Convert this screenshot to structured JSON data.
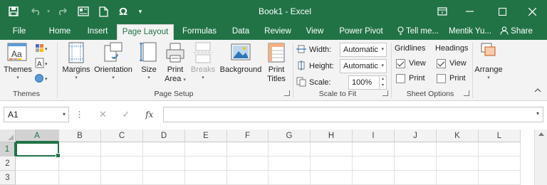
{
  "window": {
    "title": "Book1 - Excel",
    "accent": "#217346"
  },
  "quick_access": [
    "save-icon",
    "undo-icon",
    "redo-icon",
    "print-preview-icon",
    "document-icon",
    "symbol-icon",
    "customize-icon"
  ],
  "quick_access_symbol": "Ω",
  "tabs": [
    {
      "label": "File"
    },
    {
      "label": "Home"
    },
    {
      "label": "Insert"
    },
    {
      "label": "Page Layout",
      "active": true
    },
    {
      "label": "Formulas"
    },
    {
      "label": "Data"
    },
    {
      "label": "Review"
    },
    {
      "label": "View"
    },
    {
      "label": "Power Pivot"
    },
    {
      "label": "Tell me..."
    },
    {
      "label": "Mentik Yu..."
    },
    {
      "label": "Share"
    }
  ],
  "ribbon": {
    "themes": {
      "themes_label": "Themes",
      "group_label": "Themes"
    },
    "page_setup": {
      "margins": "Margins",
      "orientation": "Orientation",
      "size": "Size",
      "print_area_1": "Print",
      "print_area_2": "Area",
      "breaks": "Breaks",
      "background": "Background",
      "print_titles_1": "Print",
      "print_titles_2": "Titles",
      "group_label": "Page Setup"
    },
    "scale_to_fit": {
      "width_label": "Width:",
      "width_value": "Automatic",
      "height_label": "Height:",
      "height_value": "Automatic",
      "scale_label": "Scale:",
      "scale_value": "100%",
      "group_label": "Scale to Fit"
    },
    "sheet_options": {
      "gridlines": "Gridlines",
      "headings": "Headings",
      "view": "View",
      "print": "Print",
      "gridlines_view": true,
      "gridlines_print": false,
      "headings_view": true,
      "headings_print": false,
      "group_label": "Sheet Options"
    },
    "arrange": {
      "label": "Arrange"
    }
  },
  "formula_bar": {
    "name_box": "A1",
    "fx": "fx",
    "formula": ""
  },
  "grid": {
    "columns": [
      "A",
      "B",
      "C",
      "D",
      "E",
      "F",
      "G",
      "H",
      "I",
      "J",
      "K",
      "L"
    ],
    "rows": [
      "1",
      "2",
      "3"
    ],
    "active_cell": "A1"
  }
}
